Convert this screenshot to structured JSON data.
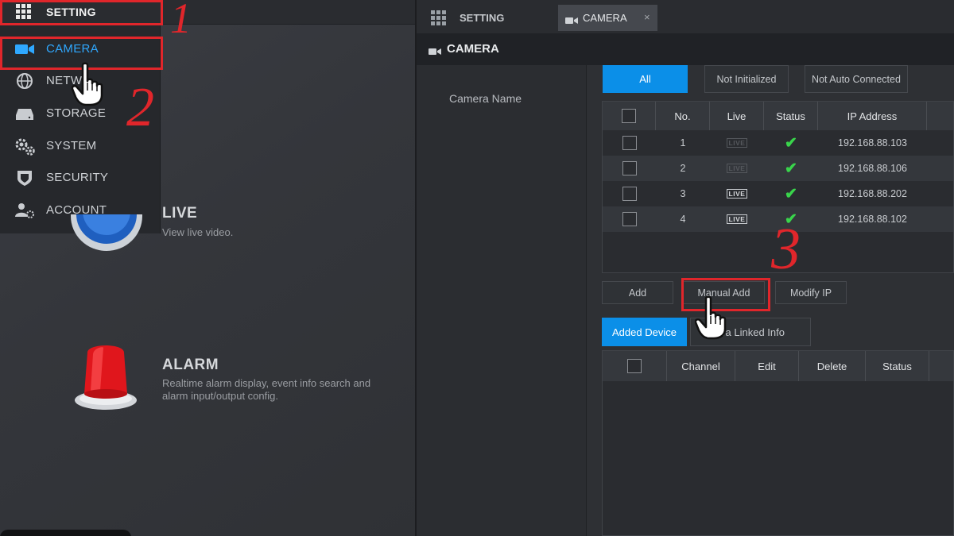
{
  "left": {
    "setting_label": "SETTING",
    "menu": [
      {
        "label": "CAMERA",
        "icon": "camera-icon",
        "active": true
      },
      {
        "label": "NETW",
        "icon": "network-icon",
        "active": false
      },
      {
        "label": "STORAGE",
        "icon": "storage-icon",
        "active": false
      },
      {
        "label": "SYSTEM",
        "icon": "gears-icon",
        "active": false
      },
      {
        "label": "SECURITY",
        "icon": "shield-icon",
        "active": false
      },
      {
        "label": "ACCOUNT",
        "icon": "user-gear-icon",
        "active": false
      }
    ],
    "features": [
      {
        "title": "LIVE",
        "desc": "View live video."
      },
      {
        "title": "ALARM",
        "desc_line1": "Realtime alarm display, event info search and",
        "desc_line2": "alarm input/output config."
      }
    ],
    "step_numbers": [
      "1",
      "2"
    ]
  },
  "right": {
    "tabs": [
      {
        "label": "SETTING",
        "icon": "grid-icon"
      },
      {
        "label": "CAMERA",
        "icon": "camera-icon",
        "close": "×"
      }
    ],
    "header_title": "CAMERA",
    "side_label": "Camera Name",
    "filter_buttons": [
      "All",
      "Not Initialized",
      "Not Auto Connected"
    ],
    "table_columns": [
      "No.",
      "Live",
      "Status",
      "IP Address"
    ],
    "table_rows": [
      {
        "no": "1",
        "live": "LIVE",
        "live_dim": true,
        "status": "✔",
        "ip": "192.168.88.103"
      },
      {
        "no": "2",
        "live": "LIVE",
        "live_dim": true,
        "status": "✔",
        "ip": "192.168.88.106"
      },
      {
        "no": "3",
        "live": "LIVE",
        "live_dim": false,
        "status": "✔",
        "ip": "192.168.88.202"
      },
      {
        "no": "4",
        "live": "LIVE",
        "live_dim": false,
        "status": "✔",
        "ip": "192.168.88.102"
      }
    ],
    "action_buttons": [
      "Add",
      "Manual Add",
      "Modify IP"
    ],
    "lower_tabs": [
      "Added Device",
      "era Linked Info"
    ],
    "added_columns": [
      "Channel",
      "Edit",
      "Delete",
      "Status"
    ],
    "step_number": "3"
  },
  "colors": {
    "accent_blue": "#0b8fe8",
    "active_menu": "#2fa8ff",
    "highlight_red": "#e0262b",
    "status_green": "#39d44b"
  }
}
